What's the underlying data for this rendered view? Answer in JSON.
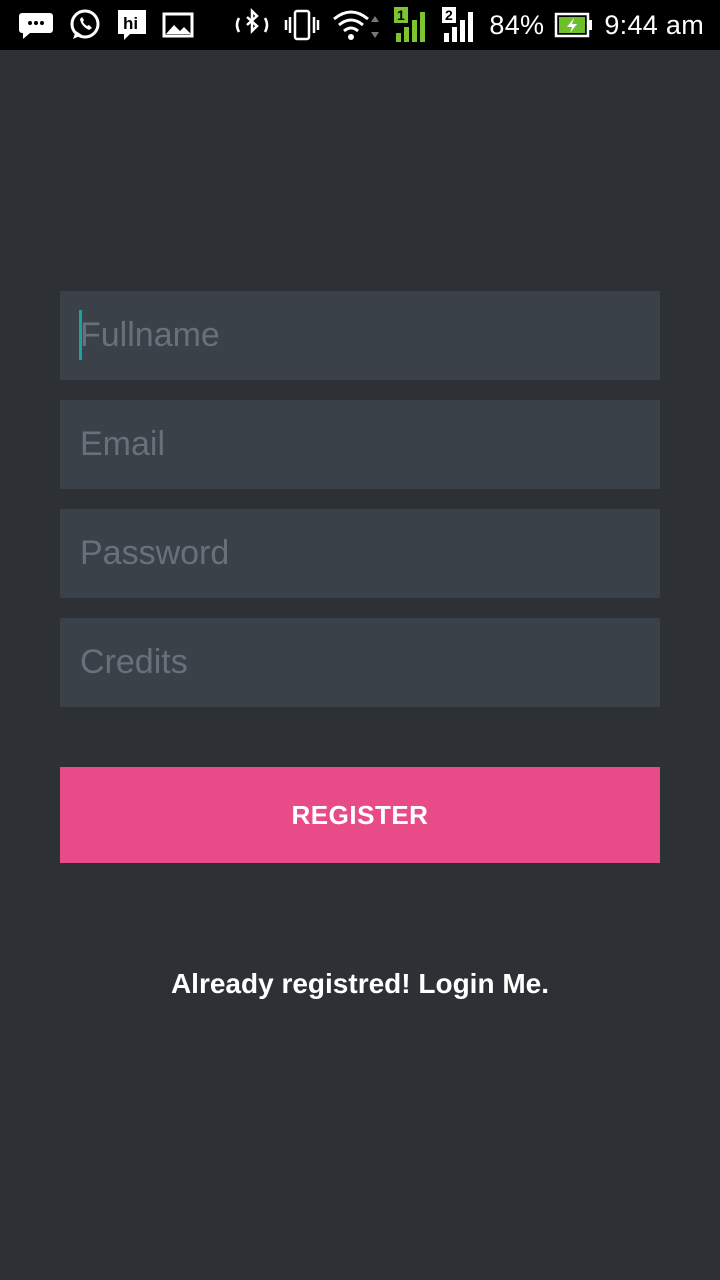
{
  "status_bar": {
    "battery_percent": "84%",
    "time": "9:44 am",
    "sim1_label": "1",
    "sim2_label": "2",
    "left_icons": [
      "message-icon",
      "whatsapp-icon",
      "hike-icon",
      "gallery-icon"
    ],
    "right_icons": [
      "bluetooth-icon",
      "vibrate-icon",
      "wifi-icon",
      "signal-sim1-icon",
      "signal-sim2-icon",
      "battery-charging-icon"
    ]
  },
  "form": {
    "fullname_placeholder": "Fullname",
    "email_placeholder": "Email",
    "password_placeholder": "Password",
    "credits_placeholder": "Credits",
    "fullname_value": "",
    "email_value": "",
    "password_value": "",
    "credits_value": ""
  },
  "register_label": "REGISTER",
  "login_link": "Already registred! Login Me.",
  "colors": {
    "background": "#2d3035",
    "field_background": "#3b4149",
    "placeholder": "#6a7079",
    "accent": "#e84c88",
    "cursor": "#1aa39a"
  }
}
